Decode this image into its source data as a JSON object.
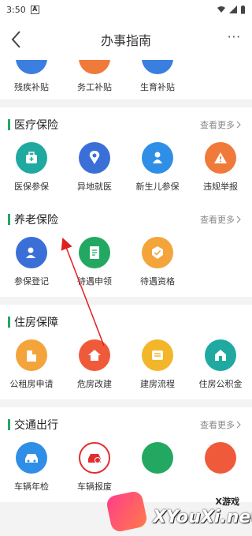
{
  "status_bar": {
    "time": "3:50",
    "badge": "A"
  },
  "header": {
    "title": "办事指南",
    "more": "···"
  },
  "top_row": [
    {
      "label": "残疾补贴",
      "color": "#3a7ee0",
      "icon": "disability-icon"
    },
    {
      "label": "务工补贴",
      "color": "#f07a3a",
      "icon": "work-icon"
    },
    {
      "label": "生育补贴",
      "color": "#3a7ee0",
      "icon": "baby-icon"
    }
  ],
  "sections": [
    {
      "name": "医疗保险",
      "more": "查看更多",
      "items": [
        {
          "label": "医保参保",
          "color": "#1fa9a1",
          "icon": "medical-kit-icon"
        },
        {
          "label": "异地就医",
          "color": "#3b6fd8",
          "icon": "location-person-icon"
        },
        {
          "label": "新生儿参保",
          "color": "#2f8fe6",
          "icon": "newborn-icon"
        },
        {
          "label": "违规举报",
          "color": "#f07a3a",
          "icon": "warning-icon"
        }
      ]
    },
    {
      "name": "养老保险",
      "more": "查看更多",
      "items": [
        {
          "label": "参保登记",
          "color": "#3b6fd8",
          "icon": "register-icon"
        },
        {
          "label": "待遇申领",
          "color": "#23a862",
          "icon": "document-icon"
        },
        {
          "label": "待遇资格",
          "color": "#f3a43a",
          "icon": "badge-check-icon"
        }
      ]
    },
    {
      "name": "住房保障",
      "more": "",
      "items": [
        {
          "label": "公租房申请",
          "color": "#f3a43a",
          "icon": "building-icon"
        },
        {
          "label": "危房改建",
          "color": "#ef5a3a",
          "icon": "house-icon"
        },
        {
          "label": "建房流程",
          "color": "#f3b62a",
          "icon": "flow-icon"
        },
        {
          "label": "住房公积金",
          "color": "#1fa9a1",
          "icon": "house-fund-icon"
        }
      ]
    },
    {
      "name": "交通出行",
      "more": "查看更多",
      "items": [
        {
          "label": "车辆年检",
          "color": "#2f8fe6",
          "icon": "car-icon"
        },
        {
          "label": "车辆报废",
          "color": "#e02e2e",
          "icon": "car-alert-icon"
        },
        {
          "label": "",
          "color": "#23a862",
          "icon": "traffic-icon"
        },
        {
          "label": "",
          "color": "#ef5a3a",
          "icon": "traffic-icon"
        }
      ]
    }
  ],
  "watermark": {
    "small": "X游戏",
    "big": "XYouXi.net"
  }
}
